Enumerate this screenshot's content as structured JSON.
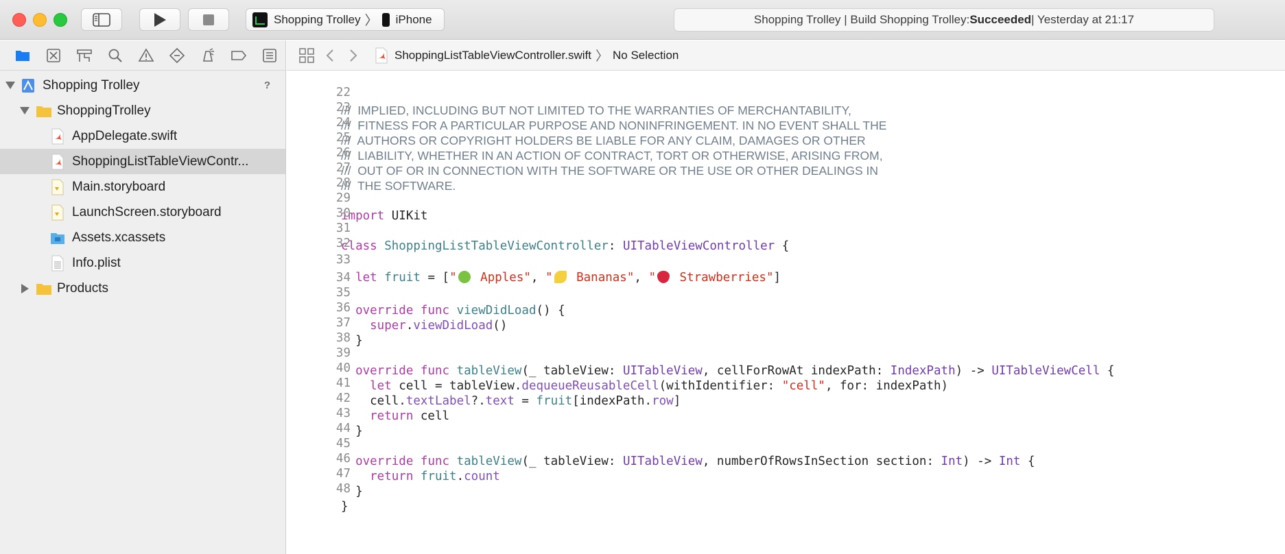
{
  "toolbar": {
    "scheme": {
      "project": "Shopping Trolley",
      "device": "iPhone"
    },
    "activity": {
      "prefix": "Shopping Trolley | Build Shopping Trolley: ",
      "status": "Succeeded",
      "suffix": " | Yesterday at 21:17"
    }
  },
  "colors": {
    "close": "#ff5f57",
    "minimize": "#febc2e",
    "zoom": "#28c840",
    "keyword": "#ad3da4",
    "string": "#d12f1b",
    "comment": "#707f8c"
  },
  "navigator": {
    "tabs": [
      "folder-icon",
      "source-control-icon",
      "symbol-icon",
      "find-icon",
      "issue-icon",
      "test-icon",
      "debug-icon",
      "breakpoint-icon",
      "report-icon"
    ],
    "tree": {
      "project": {
        "label": "Shopping Trolley",
        "badge": "?"
      },
      "group": {
        "label": "ShoppingTrolley"
      },
      "files": [
        {
          "label": "AppDelegate.swift",
          "icon": "swift-file-icon"
        },
        {
          "label": "ShoppingListTableViewContr...",
          "icon": "swift-file-icon"
        },
        {
          "label": "Main.storyboard",
          "icon": "storyboard-file-icon"
        },
        {
          "label": "LaunchScreen.storyboard",
          "icon": "storyboard-file-icon"
        },
        {
          "label": "Assets.xcassets",
          "icon": "asset-catalog-icon"
        },
        {
          "label": "Info.plist",
          "icon": "plist-file-icon"
        }
      ],
      "products": {
        "label": "Products"
      }
    }
  },
  "jumpbar": {
    "file": "ShoppingListTableViewController.swift",
    "selection": "No Selection"
  },
  "editor": {
    "lines": [
      {
        "n": "22",
        "text": "///  IMPLIED, INCLUDING BUT NOT LIMITED TO THE WARRANTIES OF MERCHANTABILITY,"
      },
      {
        "n": "23",
        "text": "///  FITNESS FOR A PARTICULAR PURPOSE AND NONINFRINGEMENT. IN NO EVENT SHALL THE"
      },
      {
        "n": "24",
        "text": "///  AUTHORS OR COPYRIGHT HOLDERS BE LIABLE FOR ANY CLAIM, DAMAGES OR OTHER"
      },
      {
        "n": "25",
        "text": "///  LIABILITY, WHETHER IN AN ACTION OF CONTRACT, TORT OR OTHERWISE, ARISING FROM,"
      },
      {
        "n": "26",
        "text": "///  OUT OF OR IN CONNECTION WITH THE SOFTWARE OR THE USE OR OTHER DEALINGS IN"
      },
      {
        "n": "27",
        "text": "///  THE SOFTWARE."
      },
      {
        "n": "28"
      },
      {
        "n": "29",
        "t1": "import",
        "t2": " UIKit"
      },
      {
        "n": "30"
      },
      {
        "n": "31",
        "t1": "class",
        "t2": " ",
        "t3": "ShoppingListTableViewController",
        "t4": ": ",
        "t5": "UITableViewController",
        "t6": " {"
      },
      {
        "n": "32"
      },
      {
        "n": "33",
        "t1": "  let",
        "t2": " ",
        "t3": "fruit",
        "t4": " = [",
        "s1": "\"",
        "s1b": " Apples\"",
        "t5": ", ",
        "s2": "\"",
        "s2b": " Bananas\"",
        "t6": ", ",
        "s3": "\"",
        "s3b": " Strawberries\"",
        "t7": "]"
      },
      {
        "n": "34"
      },
      {
        "n": "35",
        "t1": "  override",
        "t2": " ",
        "t3": "func",
        "t4": " ",
        "t5": "viewDidLoad",
        "t6": "() {"
      },
      {
        "n": "36",
        "t1": "    super",
        "t2": ".",
        "t3": "viewDidLoad",
        "t4": "()"
      },
      {
        "n": "37",
        "t1": "  }"
      },
      {
        "n": "38"
      },
      {
        "n": "39",
        "t1": "  override",
        "t2": " ",
        "t3": "func",
        "t4": " ",
        "t5": "tableView",
        "t6": "(_ tableView: ",
        "t7": "UITableView",
        "t8": ", cellForRowAt indexPath: ",
        "t9": "IndexPath",
        "t10": ") -> ",
        "t11": "UITableViewCell",
        "t12": " {"
      },
      {
        "n": "40",
        "t1": "    let",
        "t2": " cell = tableView.",
        "t3": "dequeueReusableCell",
        "t4": "(withIdentifier: ",
        "t5": "\"cell\"",
        "t6": ", for: indexPath)"
      },
      {
        "n": "41",
        "t1": "    cell.",
        "t2": "textLabel",
        "t3": "?.",
        "t4": "text",
        "t5": " = ",
        "t6": "fruit",
        "t7": "[indexPath.",
        "t8": "row",
        "t9": "]"
      },
      {
        "n": "42",
        "t1": "    return",
        "t2": " cell"
      },
      {
        "n": "43",
        "t1": "  }"
      },
      {
        "n": "44"
      },
      {
        "n": "45",
        "t1": "  override",
        "t2": " ",
        "t3": "func",
        "t4": " ",
        "t5": "tableView",
        "t6": "(_ tableView: ",
        "t7": "UITableView",
        "t8": ", numberOfRowsInSection section: ",
        "t9": "Int",
        "t10": ") -> ",
        "t11": "Int",
        "t12": " {"
      },
      {
        "n": "46",
        "t1": "    return",
        "t2": " ",
        "t3": "fruit",
        "t4": ".",
        "t5": "count"
      },
      {
        "n": "47",
        "t1": "  }"
      },
      {
        "n": "48",
        "t1": "}"
      }
    ]
  }
}
